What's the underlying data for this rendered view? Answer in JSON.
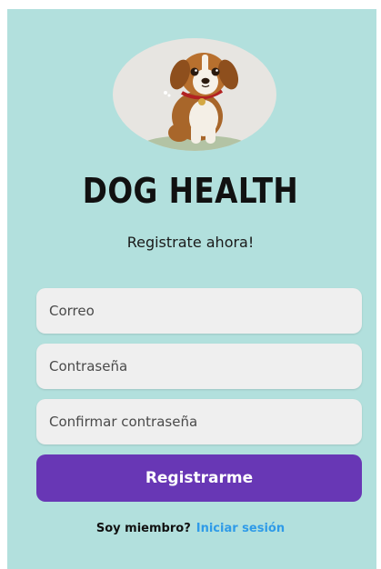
{
  "app": {
    "title": "DOG HEALTH",
    "subtitle": "Registrate ahora!",
    "logo_icon": "puppy-logo-icon"
  },
  "form": {
    "email_placeholder": "Correo",
    "password_placeholder": "Contraseña",
    "confirm_placeholder": "Confirmar contraseña",
    "submit_label": "Registrarme"
  },
  "footer": {
    "member_text": "Soy miembro?",
    "login_link": "Iniciar sesión"
  },
  "colors": {
    "background": "#b2e0dd",
    "button": "#6837b5",
    "link": "#2f9be8",
    "field": "#efefef"
  }
}
